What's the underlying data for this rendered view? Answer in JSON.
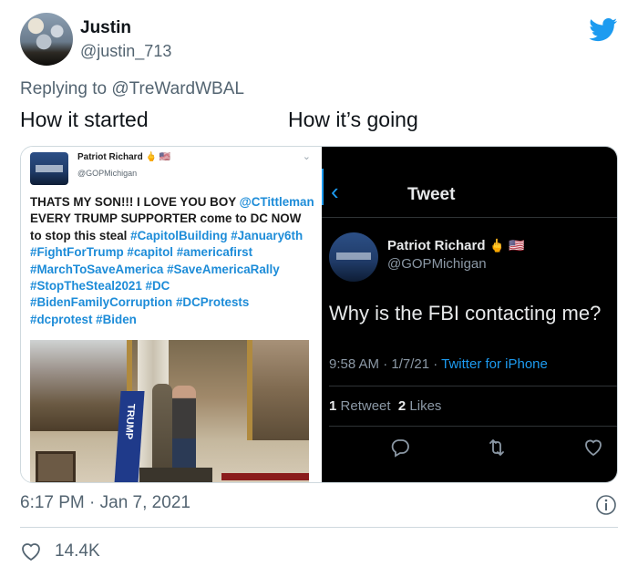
{
  "tweet": {
    "author_name": "Justin",
    "author_handle": "@justin_713",
    "replying_prefix": "Replying to",
    "replying_to": "@TreWardWBAL",
    "caption_left": "How it started",
    "caption_right": "How it’s going",
    "timestamp": "6:17 PM · Jan 7, 2021",
    "likes": "14.4K"
  },
  "left_panel": {
    "name": "Patriot Richard",
    "name_emoji": "🖕 🇺🇸",
    "handle": "@GOPMichigan",
    "text_intro": "THATS MY SON!!! I LOVE YOU BOY",
    "mention": "@CTittleman",
    "text_mid": "EVERY TRUMP SUPPORTER come to DC NOW to stop this steal",
    "hashtags": "#CapitolBuilding #January6th #FightForTrump #capitol #americafirst #MarchToSaveAmerica #SaveAmericaRally #StopTheSteal2021 #DC #BidenFamilyCorruption #DCProtests #dcprotest #Biden"
  },
  "right_panel": {
    "back_glyph": "‹",
    "header_title": "Tweet",
    "name": "Patriot Richard",
    "name_emoji": "🖕 🇺🇸",
    "handle": "@GOPMichigan",
    "text": "Why is the FBI contacting me?",
    "time_date": "9:58 AM · 1/7/21 ·",
    "source": "Twitter for iPhone",
    "retweets": "1",
    "retweets_label": "Retweet",
    "likes": "2",
    "likes_label": "Likes"
  },
  "colors": {
    "accent": "#1d9bf0",
    "muted": "#536471",
    "dark_bg": "#000000"
  },
  "icons": [
    "twitter-bird-icon",
    "chevron-down-icon",
    "back-chevron-icon",
    "reply-icon",
    "retweet-icon",
    "heart-icon",
    "info-icon"
  ]
}
